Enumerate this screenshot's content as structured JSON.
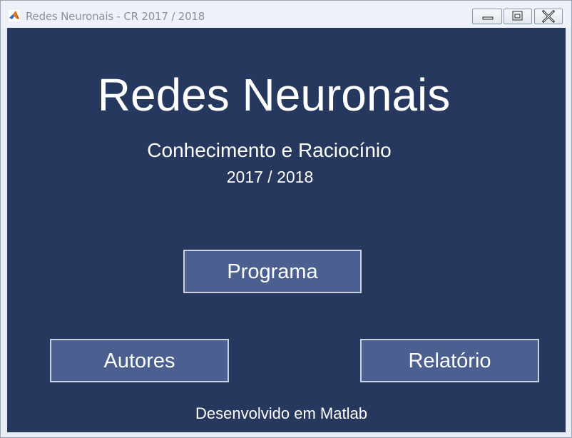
{
  "window": {
    "title": "Redes Neuronais - CR 2017 / 2018",
    "icon": "matlab-logo-icon",
    "controls": [
      "minimize-icon",
      "maximize-icon",
      "close-icon"
    ]
  },
  "main": {
    "heading": "Redes Neuronais",
    "subtitle": "Conhecimento e Raciocínio",
    "year": "2017 / 2018",
    "buttons": {
      "programa": "Programa",
      "autores": "Autores",
      "relatorio": "Relatório"
    },
    "footer": "Desenvolvido em Matlab"
  },
  "colors": {
    "background": "#26385e",
    "button": "#4b6090",
    "button_border": "#c9d1de",
    "text": "#ffffff"
  }
}
